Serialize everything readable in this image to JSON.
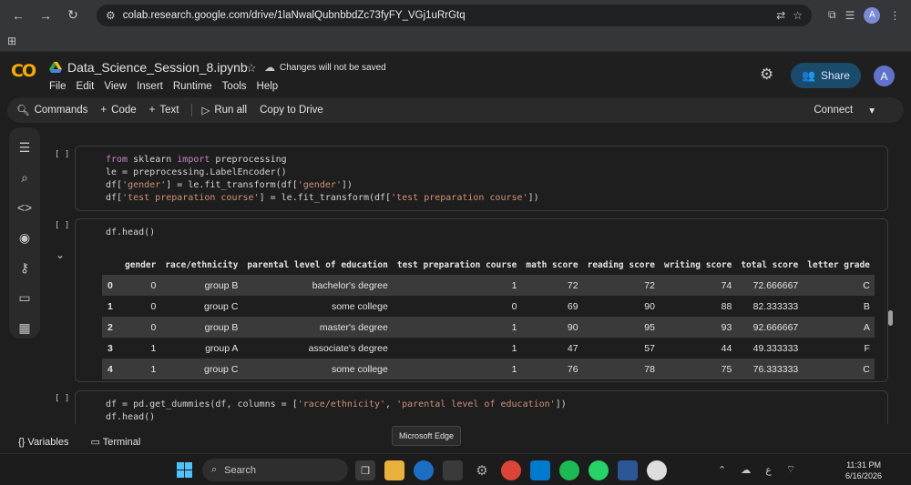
{
  "browser": {
    "url": "colab.research.google.com/drive/1laNwalQubnbbdZc73fyFY_VGj1uRrGtq",
    "profile_initial": "A"
  },
  "colab": {
    "notebook_title": "Data_Science_Session_8.ipynb",
    "save_status": "Changes will not be saved",
    "menu": [
      "File",
      "Edit",
      "View",
      "Insert",
      "Runtime",
      "Tools",
      "Help"
    ],
    "share_label": "Share",
    "user_initial": "A"
  },
  "toolbar": {
    "commands": "Commands",
    "code": "Code",
    "text": "Text",
    "run_all": "Run all",
    "copy_to_drive": "Copy to Drive",
    "connect": "Connect"
  },
  "cells": [
    {
      "bracket": "[ ]",
      "lines": [
        "from sklearn import preprocessing",
        "le = preprocessing.LabelEncoder()",
        "df['gender'] = le.fit_transform(df['gender'])",
        "df['test preparation course'] = le.fit_transform(df['test preparation course'])"
      ]
    },
    {
      "bracket": "[ ]",
      "lines": [
        "df.head()"
      ]
    },
    {
      "bracket": "[ ]",
      "lines": [
        "df = pd.get_dummies(df, columns = ['race/ethnicity', 'parental level of education'])",
        "df.head()"
      ]
    }
  ],
  "dataframe": {
    "columns": [
      "",
      "gender",
      "race/ethnicity",
      "parental level of education",
      "test preparation course",
      "math score",
      "reading score",
      "writing score",
      "total score",
      "letter grade"
    ],
    "rows": [
      [
        "0",
        "0",
        "group B",
        "bachelor's degree",
        "1",
        "72",
        "72",
        "74",
        "72.666667",
        "C"
      ],
      [
        "1",
        "0",
        "group C",
        "some college",
        "0",
        "69",
        "90",
        "88",
        "82.333333",
        "B"
      ],
      [
        "2",
        "0",
        "group B",
        "master's degree",
        "1",
        "90",
        "95",
        "93",
        "92.666667",
        "A"
      ],
      [
        "3",
        "1",
        "group A",
        "associate's degree",
        "1",
        "47",
        "57",
        "44",
        "49.333333",
        "F"
      ],
      [
        "4",
        "1",
        "group C",
        "some college",
        "1",
        "76",
        "78",
        "75",
        "76.333333",
        "C"
      ]
    ]
  },
  "status_bar": {
    "variables": "Variables",
    "terminal": "Terminal"
  },
  "tooltip": "Microsoft Edge",
  "taskbar": {
    "search_placeholder": "Search",
    "time": "11:31 PM",
    "date": "6/16/2026",
    "lang": "ع"
  }
}
